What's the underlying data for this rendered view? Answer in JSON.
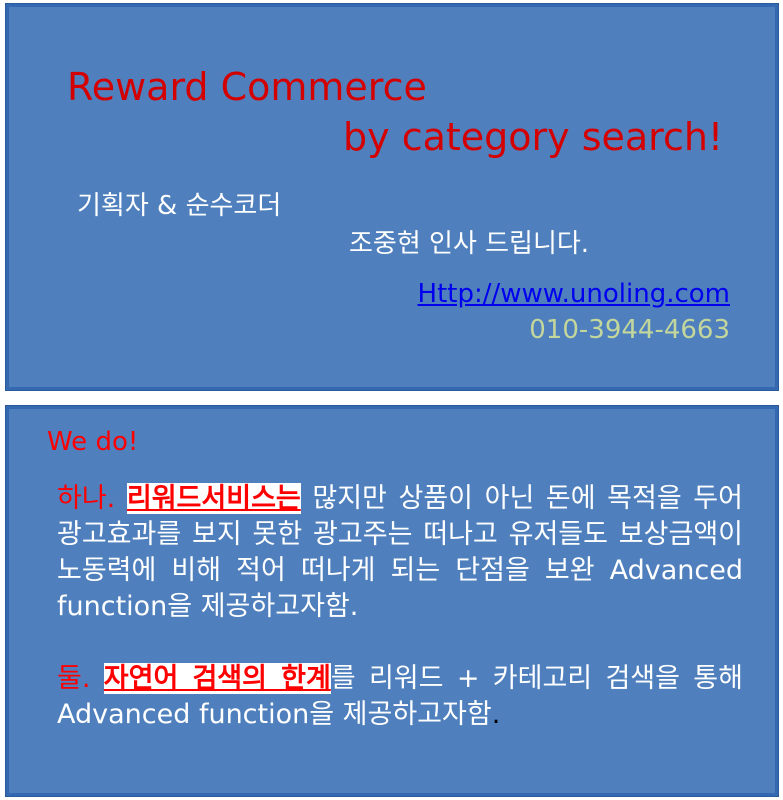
{
  "card_top": {
    "title_line1": "Reward Commerce",
    "title_line2": "by category search!",
    "role": "기획자 & 순수코더",
    "greeting": "조중현 인사 드립니다.",
    "url": "Http://www.unoling.com",
    "phone": "010-3944-4663"
  },
  "card_bottom": {
    "heading": "We do!",
    "item1": {
      "number": "하나.",
      "highlight": "리워드서비스는",
      "text": " 많지만 상품이 아닌 돈에 목적을 두어 광고효과를 보지 못한 광고주는 떠나고 유저들도 보상금액이 노동력에 비해 적어 떠나게 되는 단점을 보완 Advanced function을 제공하고자함."
    },
    "item2": {
      "number": "둘.",
      "highlight": "자연어 검색의 한계",
      "text": "를 리워드 + 카테고리 검색을 통해 Advanced function을 제공하고자함",
      "end": "."
    }
  },
  "colors": {
    "card_bg": "#4f80bd",
    "card_border": "#3468b0",
    "title": "#d40000",
    "highlight": "#ff0000",
    "link": "#0000ee",
    "phone": "#c3d69b"
  }
}
